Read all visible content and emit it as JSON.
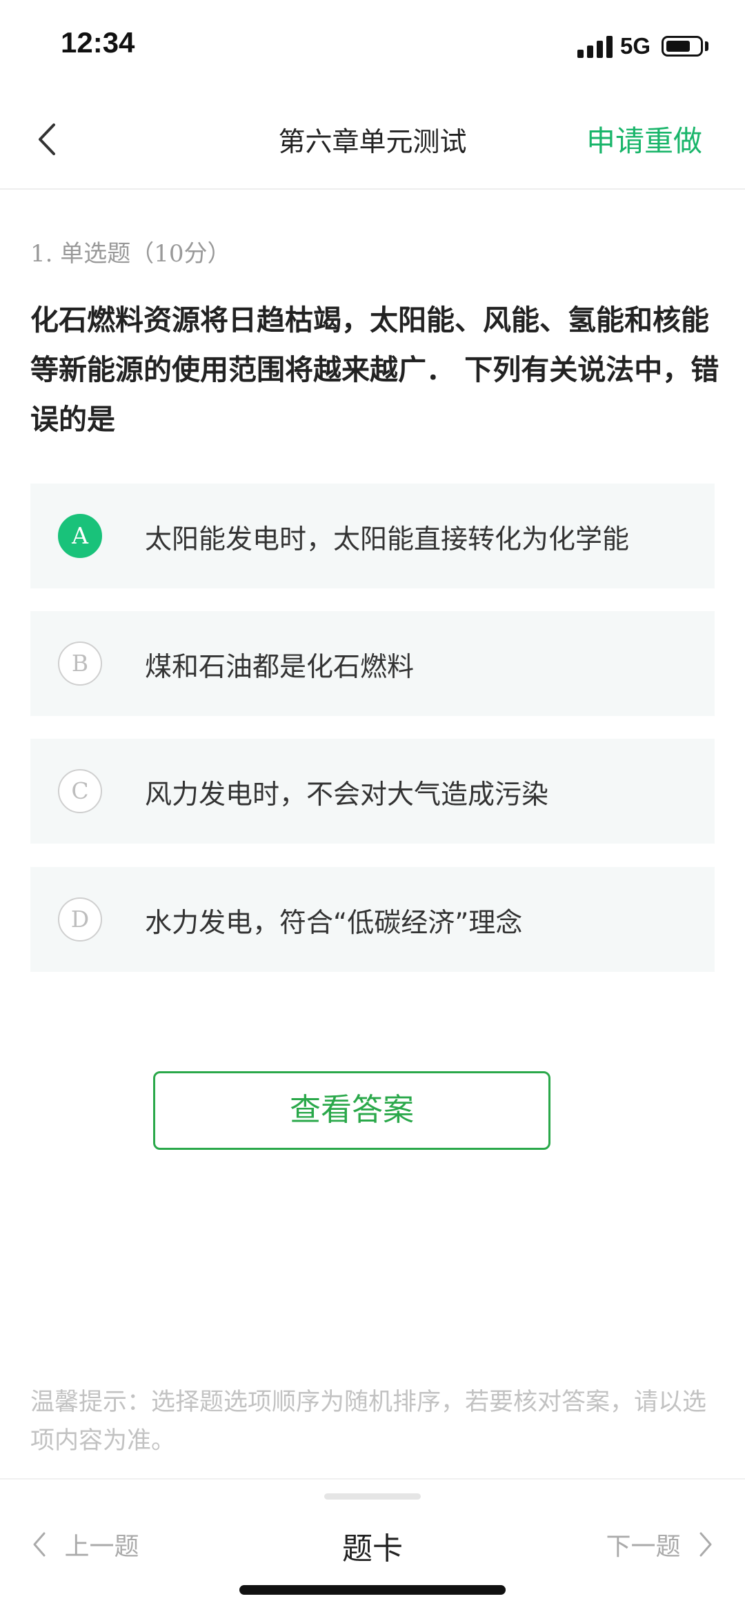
{
  "status_bar": {
    "time": "12:34",
    "network": "5G",
    "icons": [
      "signal-icon",
      "battery-icon"
    ]
  },
  "nav": {
    "back_icon": "chevron-left-icon",
    "title": "第六章单元测试",
    "action": "申请重做"
  },
  "question": {
    "meta": "1. 单选题（10分）",
    "text": "化石燃料资源将日趋枯竭，太阳能、风能、氢能和核能等新能源的使用范围将越来越广． 下列有关说法中，错误的是"
  },
  "options": [
    {
      "letter": "A",
      "text": "太阳能发电时，太阳能直接转化为化学能",
      "selected": true
    },
    {
      "letter": "B",
      "text": "煤和石油都是化石燃料",
      "selected": false
    },
    {
      "letter": "C",
      "text": "风力发电时，不会对大气造成污染",
      "selected": false
    },
    {
      "letter": "D",
      "text": "水力发电，符合“低碳经济”理念",
      "selected": false
    }
  ],
  "answer_button": "查看答案",
  "tip": "温馨提示：选择题选项顺序为随机排序，若要核对答案，请以选项内容为准。",
  "bottom_bar": {
    "prev": "上一题",
    "card": "题卡",
    "next": "下一题"
  },
  "colors": {
    "accent": "#19b56a",
    "selected_badge": "#19c27a",
    "button_border": "#2aa84a"
  }
}
